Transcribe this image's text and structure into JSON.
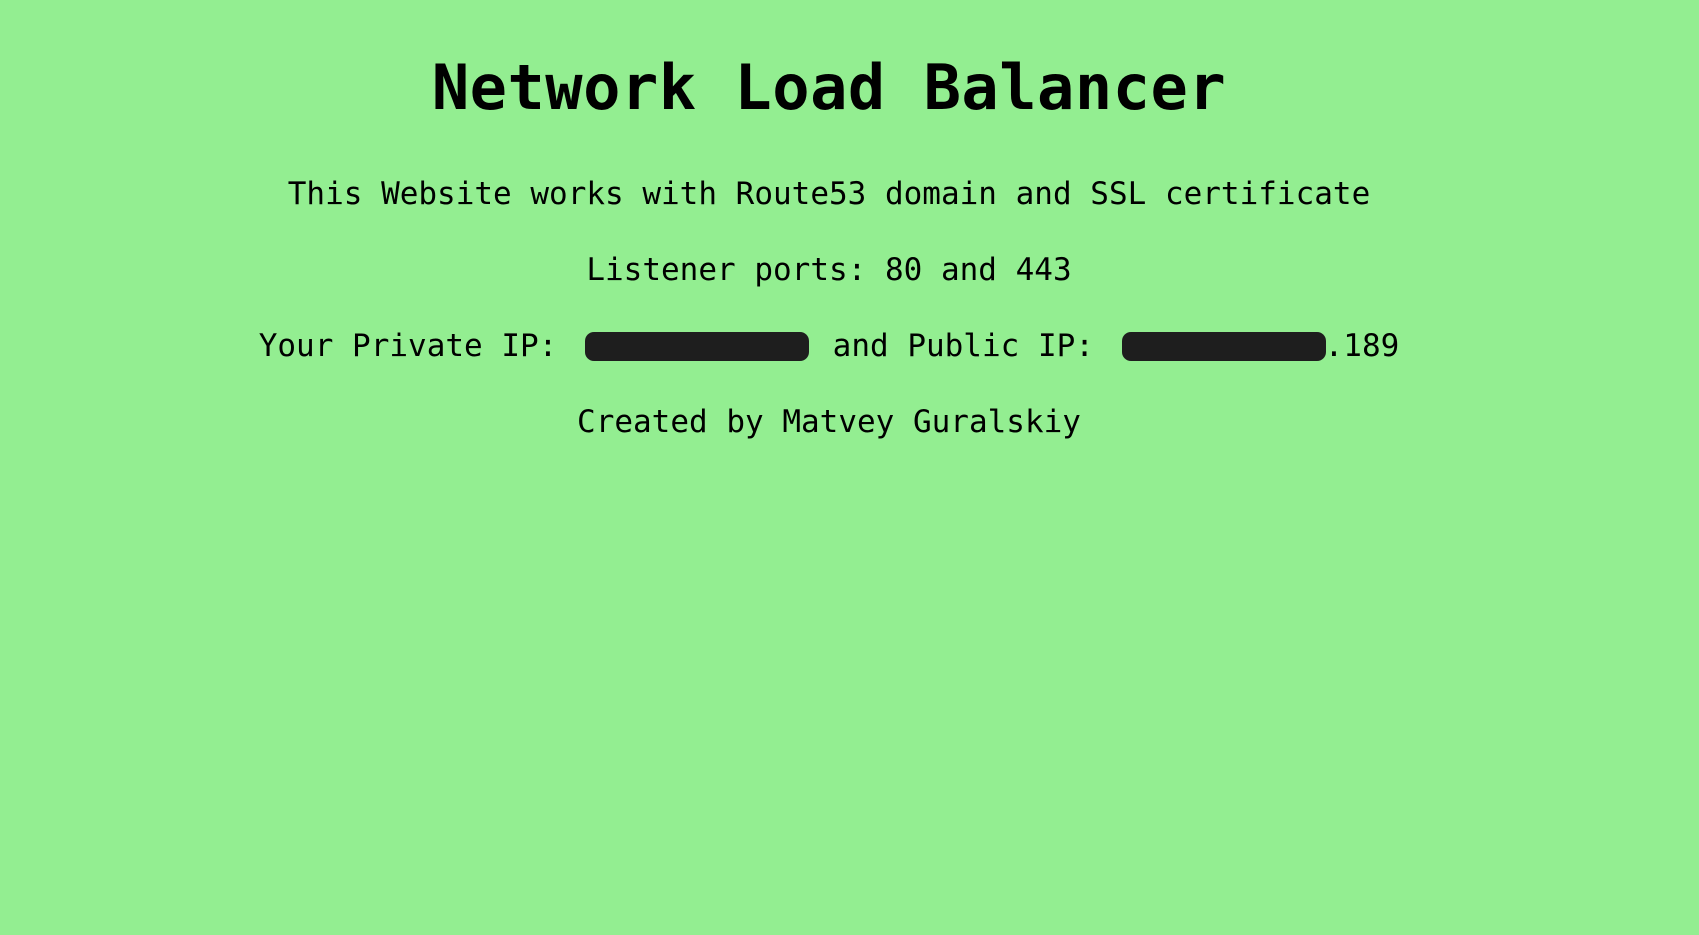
{
  "page": {
    "title": "Network Load Balancer",
    "description": "This Website works with Route53 domain and SSL certificate",
    "ports": "Listener ports: 80 and 443",
    "ip_line": {
      "private_label": "Your Private IP:",
      "joiner": "and Public IP:",
      "public_suffix": ".189"
    },
    "credit": "Created by Matvey Guralskiy"
  },
  "colors": {
    "background": "#93ee91",
    "text": "#000000",
    "redaction": "#1e1e1e"
  }
}
